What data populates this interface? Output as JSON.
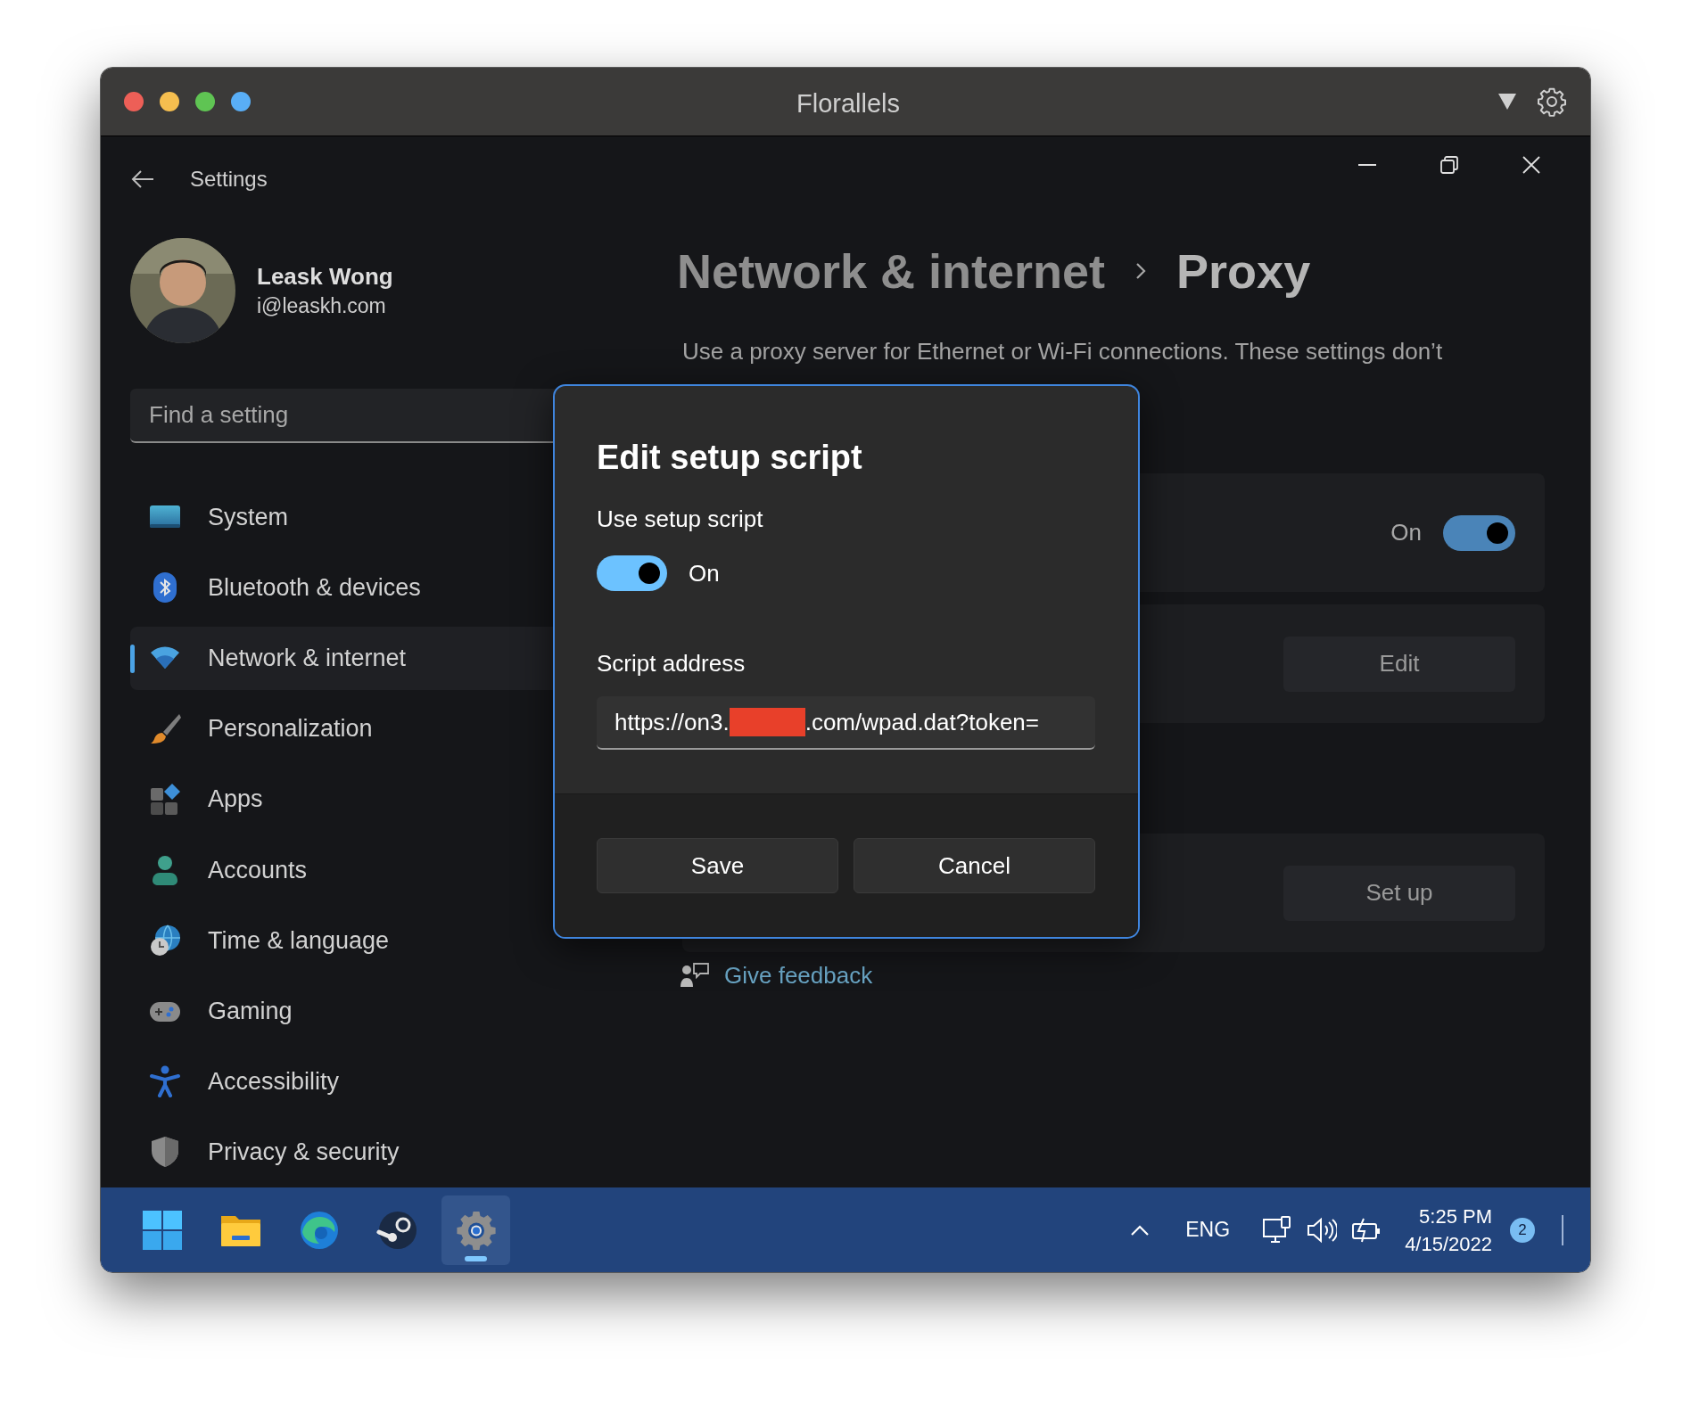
{
  "window": {
    "title": "Florallels"
  },
  "app": {
    "title": "Settings"
  },
  "user": {
    "name": "Leask Wong",
    "email": "i@leaskh.com"
  },
  "search": {
    "placeholder": "Find a setting"
  },
  "nav": [
    {
      "label": "System",
      "selected": false
    },
    {
      "label": "Bluetooth & devices",
      "selected": false
    },
    {
      "label": "Network & internet",
      "selected": true
    },
    {
      "label": "Personalization",
      "selected": false
    },
    {
      "label": "Apps",
      "selected": false
    },
    {
      "label": "Accounts",
      "selected": false
    },
    {
      "label": "Time & language",
      "selected": false
    },
    {
      "label": "Gaming",
      "selected": false
    },
    {
      "label": "Accessibility",
      "selected": false
    },
    {
      "label": "Privacy & security",
      "selected": false
    }
  ],
  "breadcrumb": [
    "Network & internet",
    "Proxy"
  ],
  "description_lines": [
    "Use a proxy server for Ethernet or Wi-Fi connections. These settings don’t"
  ],
  "cards": [
    {
      "kind": "toggle",
      "state_label": "On",
      "on": true
    },
    {
      "kind": "button",
      "button": "Edit"
    },
    {
      "kind": "button",
      "button": "Set up"
    }
  ],
  "feedback": "Give feedback",
  "dialog": {
    "title": "Edit setup script",
    "toggle_label": "Use setup script",
    "toggle_on": true,
    "toggle_state": "On",
    "field_label": "Script address",
    "field_value_start": "https://on3.",
    "redacted": true,
    "field_value_end": ".com/wpad.dat?token=",
    "buttons": [
      "Save",
      "Cancel"
    ]
  },
  "taskbar": {
    "apps": [
      {
        "selected": false
      },
      {
        "selected": false
      },
      {
        "selected": false
      },
      {
        "selected": false
      },
      {
        "selected": true
      }
    ],
    "language": "ENG",
    "time": "5:25 PM",
    "date": "4/15/2022",
    "notifications": "2"
  }
}
